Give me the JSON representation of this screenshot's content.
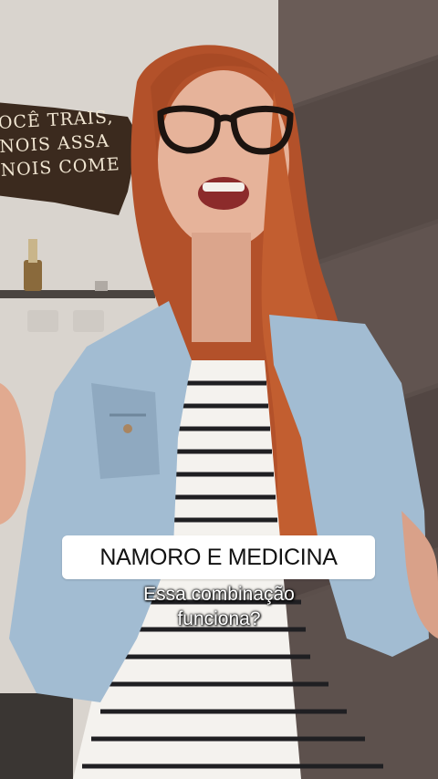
{
  "sign": {
    "lines": [
      "OCÊ TRAIS,",
      "NOIS ASSA",
      "NOIS COME"
    ]
  },
  "caption": {
    "title": "NAMORO E MEDICINA",
    "subtitle_line1": "Essa combinação",
    "subtitle_line2": "funciona?"
  },
  "colors": {
    "wall": "#d8d3cd",
    "tile": "#5a4e4a",
    "denim": "#9fb9cf",
    "hair": "#b9542a",
    "caption_box": "#ffffff"
  }
}
